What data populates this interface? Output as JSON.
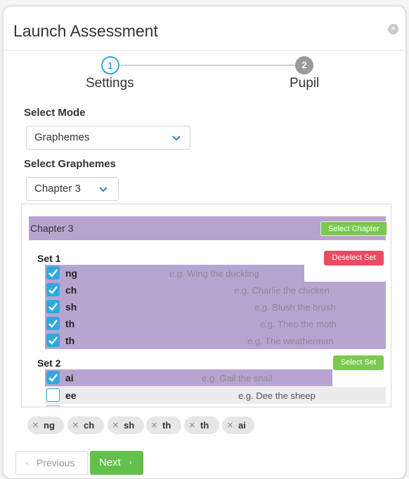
{
  "modal": {
    "title": "Launch Assessment",
    "close_icon": "close-icon"
  },
  "stepper": {
    "steps": [
      {
        "number": "1",
        "label": "Settings",
        "state": "active"
      },
      {
        "number": "2",
        "label": "Pupil",
        "state": "inactive"
      }
    ]
  },
  "mode": {
    "label": "Select Mode",
    "value": "Graphemes"
  },
  "graphemes": {
    "label": "Select Graphemes",
    "value": "Chapter 3"
  },
  "chapter": {
    "name": "Chapter 3",
    "select_label": "Select Chapter",
    "sets": [
      {
        "name": "Set 1",
        "button_label": "Deselect Set",
        "items": [
          {
            "name": "ng",
            "example": "e.g. Wing the duckling",
            "checked": true
          },
          {
            "name": "ch",
            "example": "e.g. Charlie the chicken",
            "checked": true
          },
          {
            "name": "sh",
            "example": "e.g. Blush the brush",
            "checked": true
          },
          {
            "name": "th",
            "example": "e.g. Theo the moth",
            "checked": true
          },
          {
            "name": "th",
            "example": "e.g. The weatherman",
            "checked": true
          }
        ]
      },
      {
        "name": "Set 2",
        "button_label": "Select Set",
        "items": [
          {
            "name": "ai",
            "example": "e.g. Gail the snail",
            "checked": true
          },
          {
            "name": "ee",
            "example": "e.g. Dee the sheep",
            "checked": false
          }
        ]
      }
    ]
  },
  "selected_chips": [
    "ng",
    "ch",
    "sh",
    "th",
    "th",
    "ai"
  ],
  "footer": {
    "previous_label": "Previous",
    "next_label": "Next"
  },
  "colors": {
    "accent_blue": "#2ea9e0",
    "selected_row": "#b8a4d0",
    "green": "#7bc950",
    "red": "#e94b63"
  }
}
